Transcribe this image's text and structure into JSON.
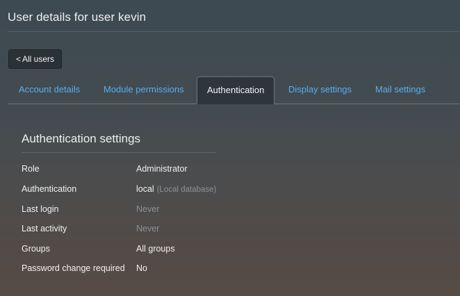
{
  "header": {
    "title": "User details for user kevin"
  },
  "back_button": {
    "chevron": "<",
    "label": "All users"
  },
  "tabs": [
    {
      "label": "Account details",
      "active": false
    },
    {
      "label": "Module permissions",
      "active": false
    },
    {
      "label": "Authentication",
      "active": true
    },
    {
      "label": "Display settings",
      "active": false
    },
    {
      "label": "Mail settings",
      "active": false
    }
  ],
  "section": {
    "title": "Authentication settings",
    "rows": [
      {
        "label": "Role",
        "value": "Administrator",
        "sub": ""
      },
      {
        "label": "Authentication",
        "value": "local",
        "sub": "(Local database)"
      },
      {
        "label": "Last login",
        "value": "Never",
        "sub": ""
      },
      {
        "label": "Last activity",
        "value": "Never",
        "sub": ""
      },
      {
        "label": "Groups",
        "value": "All groups",
        "sub": ""
      },
      {
        "label": "Password change required",
        "value": "No",
        "sub": ""
      }
    ]
  },
  "colors": {
    "link": "#5aaef0",
    "active_tab_bg": "#2e363b",
    "muted_text": "#8c9296"
  }
}
